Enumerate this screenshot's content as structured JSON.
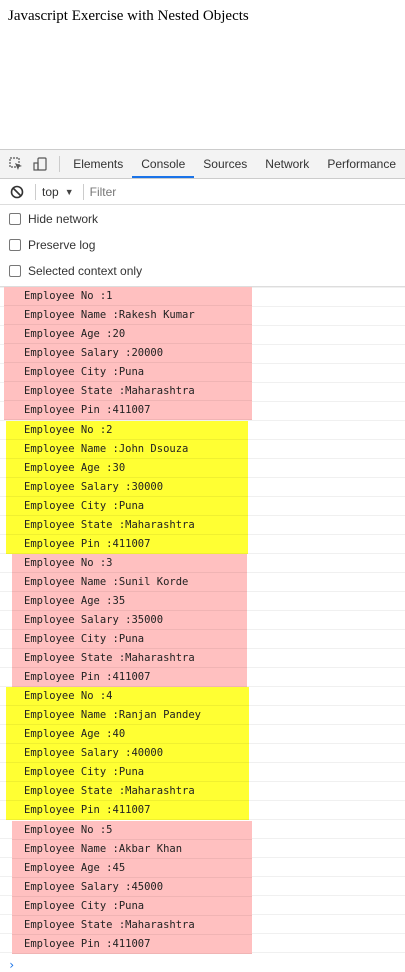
{
  "page": {
    "heading": "Javascript Exercise with Nested Objects"
  },
  "devtools": {
    "tabs": [
      {
        "label": "Elements",
        "active": false
      },
      {
        "label": "Console",
        "active": true
      },
      {
        "label": "Sources",
        "active": false
      },
      {
        "label": "Network",
        "active": false
      },
      {
        "label": "Performance",
        "active": false
      }
    ],
    "context": "top",
    "filter_placeholder": "Filter",
    "settings": [
      {
        "label": "Hide network"
      },
      {
        "label": "Preserve log"
      },
      {
        "label": "Selected context only"
      }
    ],
    "prompt_symbol": "›"
  },
  "colors": {
    "pink": "#ffc0c0",
    "yellow": "#ffff33",
    "accent": "#1a73e8"
  },
  "console": {
    "groups": [
      {
        "color": "pink",
        "lines": [
          "Employee No :1",
          "Employee Name :Rakesh Kumar",
          "Employee Age :20",
          "Employee Salary :20000",
          "Employee City :Puna",
          "Employee State :Maharashtra",
          "Employee Pin :411007"
        ]
      },
      {
        "color": "yellow",
        "lines": [
          "Employee No :2",
          "Employee Name :John Dsouza",
          "Employee Age :30",
          "Employee Salary :30000",
          "Employee City :Puna",
          "Employee State :Maharashtra",
          "Employee Pin :411007"
        ]
      },
      {
        "color": "pink",
        "lines": [
          "Employee No :3",
          "Employee Name :Sunil Korde",
          "Employee Age :35",
          "Employee Salary :35000",
          "Employee City :Puna",
          "Employee State :Maharashtra",
          "Employee Pin :411007"
        ]
      },
      {
        "color": "yellow",
        "lines": [
          "Employee No :4",
          "Employee Name :Ranjan Pandey",
          "Employee Age :40",
          "Employee Salary :40000",
          "Employee City :Puna",
          "Employee State :Maharashtra",
          "Employee Pin :411007"
        ]
      },
      {
        "color": "pink",
        "lines": [
          "Employee No :5",
          "Employee Name :Akbar Khan",
          "Employee Age :45",
          "Employee Salary :45000",
          "Employee City :Puna",
          "Employee State :Maharashtra",
          "Employee Pin :411007"
        ]
      }
    ]
  }
}
